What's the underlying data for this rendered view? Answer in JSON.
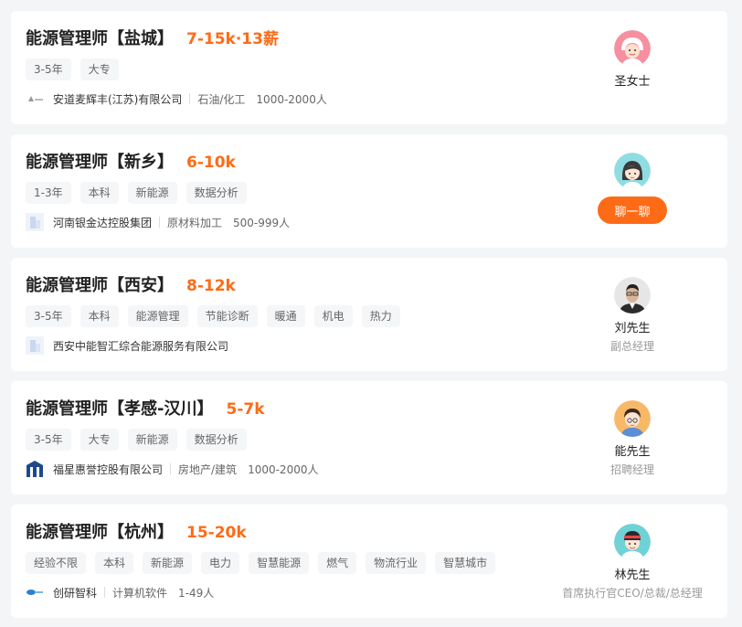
{
  "jobs": [
    {
      "title": "能源管理师【盐城】",
      "salary": "7-15k·13薪",
      "tags": [
        "3-5年",
        "大专"
      ],
      "company": "安道麦辉丰(江苏)有限公司",
      "industry": "石油/化工",
      "size": "1000-2000人",
      "recruiter_name": "圣女士",
      "recruiter_title": ""
    },
    {
      "title": "能源管理师【新乡】",
      "salary": "6-10k",
      "tags": [
        "1-3年",
        "本科",
        "新能源",
        "数据分析"
      ],
      "company": "河南银金达控股集团",
      "industry": "原材料加工",
      "size": "500-999人",
      "recruiter_name": "",
      "recruiter_title": "",
      "chat_label": "聊一聊"
    },
    {
      "title": "能源管理师【西安】",
      "salary": "8-12k",
      "tags": [
        "3-5年",
        "本科",
        "能源管理",
        "节能诊断",
        "暖通",
        "机电",
        "热力"
      ],
      "company": "西安中能智汇综合能源服务有限公司",
      "industry": "",
      "size": "",
      "recruiter_name": "刘先生",
      "recruiter_title": "副总经理"
    },
    {
      "title": "能源管理师【孝感-汉川】",
      "salary": "5-7k",
      "tags": [
        "3-5年",
        "大专",
        "新能源",
        "数据分析"
      ],
      "company": "福星惠誉控股有限公司",
      "industry": "房地产/建筑",
      "size": "1000-2000人",
      "recruiter_name": "能先生",
      "recruiter_title": "招聘经理"
    },
    {
      "title": "能源管理师【杭州】",
      "salary": "15-20k",
      "tags": [
        "经验不限",
        "本科",
        "新能源",
        "电力",
        "智慧能源",
        "燃气",
        "物流行业",
        "智慧城市"
      ],
      "company": "创研智科",
      "industry": "计算机软件",
      "size": "1-49人",
      "recruiter_name": "林先生",
      "recruiter_title": "首席执行官CEO/总裁/总经理"
    }
  ],
  "colors": {
    "accent": "#fe6b16",
    "background": "#f4f5f7",
    "card": "#ffffff"
  }
}
